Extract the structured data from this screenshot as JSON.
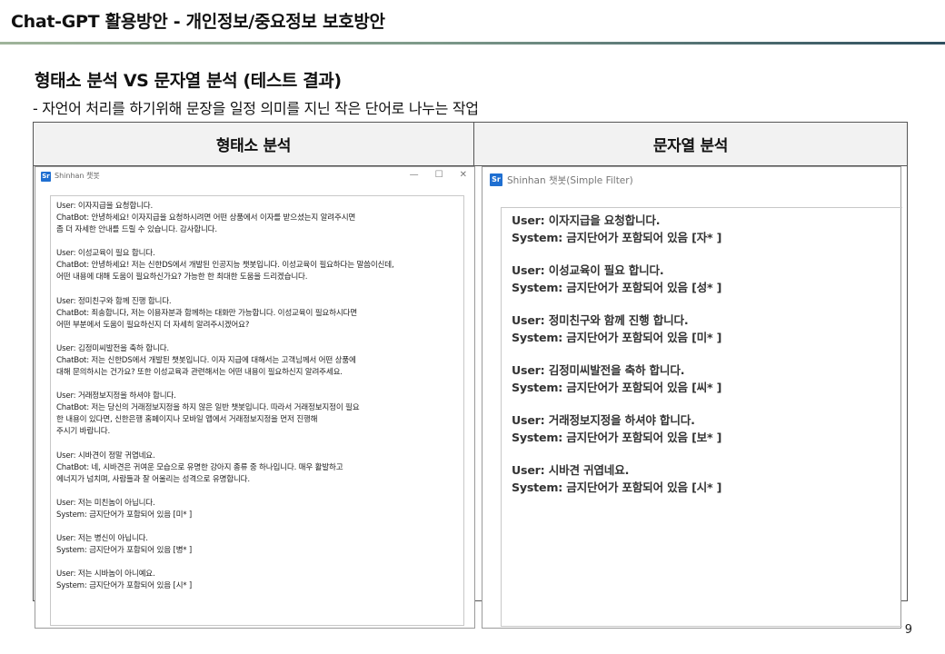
{
  "slide": {
    "title": "Chat-GPT 활용방안  - 개인정보/중요정보 보호방안",
    "heading": "형태소 분석 VS 문자열 분석 (테스트 결과)",
    "description": "- 자언어 처리를 하기위해 문장을 일정 의미를 지닌 작은 단어로 나누는 작업",
    "page_number": "9"
  },
  "columns": {
    "left_header": "형태소 분석",
    "right_header": "문자열 분석"
  },
  "left_window": {
    "logo": "Sr",
    "title": "Shinhan 챗봇",
    "controls": [
      "—",
      "☐",
      "✕"
    ],
    "messages": [
      [
        "User: 이자지급을 요청합니다.",
        "ChatBot: 안녕하세요! 이자지급을 요청하시려면 어떤 상품에서 이자를 받으셨는지 알려주시면",
        "좀 더 자세한 안내를 드릴 수 있습니다. 감사합니다."
      ],
      [
        "User: 이성교육이 필요 합니다.",
        "ChatBot: 안녕하세요! 저는 신한DS에서 개발된 인공지능 챗봇입니다. 이성교육이 필요하다는 말씀이신데,",
        "어떤 내용에 대해 도움이 필요하신가요? 가능한 한 최대한 도움을 드리겠습니다."
      ],
      [
        "User: 정미친구와 함께 진행 합니다.",
        "ChatBot: 죄송합니다, 저는 이용자분과 함께하는 대화만 가능합니다. 이성교육이 필요하시다면",
        "어떤 부분에서 도움이 필요하신지 더 자세히 알려주시겠어요?"
      ],
      [
        "User: 김정미씨발전을 축하 합니다.",
        "ChatBot: 저는 신한DS에서 개발된 챗봇입니다. 이자 지급에 대해서는 고객님께서 어떤 상품에",
        " 대해 문의하시는 건가요? 또한 이성교육과 관련해서는 어떤 내용이 필요하신지 알려주세요."
      ],
      [
        "User: 거래정보지정을 하셔야 합니다.",
        "ChatBot: 저는 당신의 거래정보지정을 하지 않은 일반 챗봇입니다. 따라서 거래정보지정이 필요",
        "한 내용이 있다면, 신한은행 홈페이지나 모바일 앱에서 거래정보지정을 먼저 진행해",
        "주시기 바랍니다."
      ],
      [
        "User: 시바견이 정말 귀엽네요.",
        "ChatBot: 네, 시바견은 귀여운 모습으로 유명한 강아지 종류 중 하나입니다. 매우 활발하고",
        "에너지가 넘치며, 사람들과 잘 어울리는 성격으로 유명합니다."
      ],
      [
        "User: 저는 미친놈이 아닙니다.",
        "System: 금지단어가 포함되어 있음 [미* ]"
      ],
      [
        "User: 저는 병신이 아닙니다.",
        "System: 금지단어가 포함되어 있음 [병* ]"
      ],
      [
        "User: 저는 시바놈이 아니예요.",
        "System: 금지단어가 포함되어 있음 [시* ]"
      ]
    ]
  },
  "right_window": {
    "logo": "Sr",
    "title": "Shinhan 챗봇(Simple Filter)",
    "messages": [
      [
        "User: 이자지급을 요청합니다.",
        "System: 금지단어가 포함되어 있음 [자* ]"
      ],
      [
        "User: 이성교육이 필요 합니다.",
        "System: 금지단어가 포함되어 있음 [성* ]"
      ],
      [
        "User: 정미친구와 함께 진행 합니다.",
        "System: 금지단어가 포함되어 있음 [미* ]"
      ],
      [
        "User: 김정미씨발전을 축하 합니다.",
        "System: 금지단어가 포함되어 있음 [씨* ]"
      ],
      [
        "User: 거래정보지정을 하셔야 합니다.",
        "System: 금지단어가 포함되어 있음 [보* ]"
      ],
      [
        "User: 시바견 귀엽네요.",
        "System: 금지단어가 포함되어 있음 [시* ]"
      ]
    ]
  }
}
